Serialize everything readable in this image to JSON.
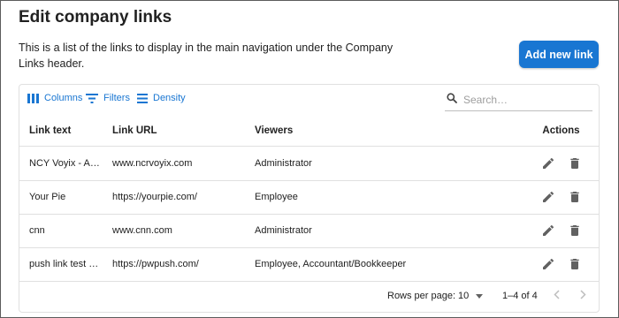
{
  "page": {
    "title": "Edit company links",
    "description": "This is a list of the links to display in the main navigation under the Company Links header.",
    "add_button_label": "Add new link",
    "accent_color": "#1976d2"
  },
  "toolbar": {
    "columns_label": "Columns",
    "filters_label": "Filters",
    "density_label": "Density",
    "search_placeholder": "Search…",
    "search_value": ""
  },
  "table": {
    "headers": {
      "link_text": "Link text",
      "link_url": "Link URL",
      "viewers": "Viewers",
      "actions": "Actions"
    },
    "rows": [
      {
        "link_text": "NCY Voyix - A…",
        "link_url": "www.ncrvoyix.com",
        "viewers": "Administrator"
      },
      {
        "link_text": "Your Pie",
        "link_url": "https://yourpie.com/",
        "viewers": "Employee"
      },
      {
        "link_text": "cnn",
        "link_url": "www.cnn.com",
        "viewers": "Administrator"
      },
      {
        "link_text": "push link test …",
        "link_url": "https://pwpush.com/",
        "viewers": "Employee, Accountant/Bookkeeper"
      }
    ],
    "row_action_icons": [
      "edit-icon",
      "delete-icon"
    ]
  },
  "pagination": {
    "rows_per_page_label": "Rows per page:",
    "rows_per_page_value": "10",
    "range_text": "1–4 of 4"
  }
}
